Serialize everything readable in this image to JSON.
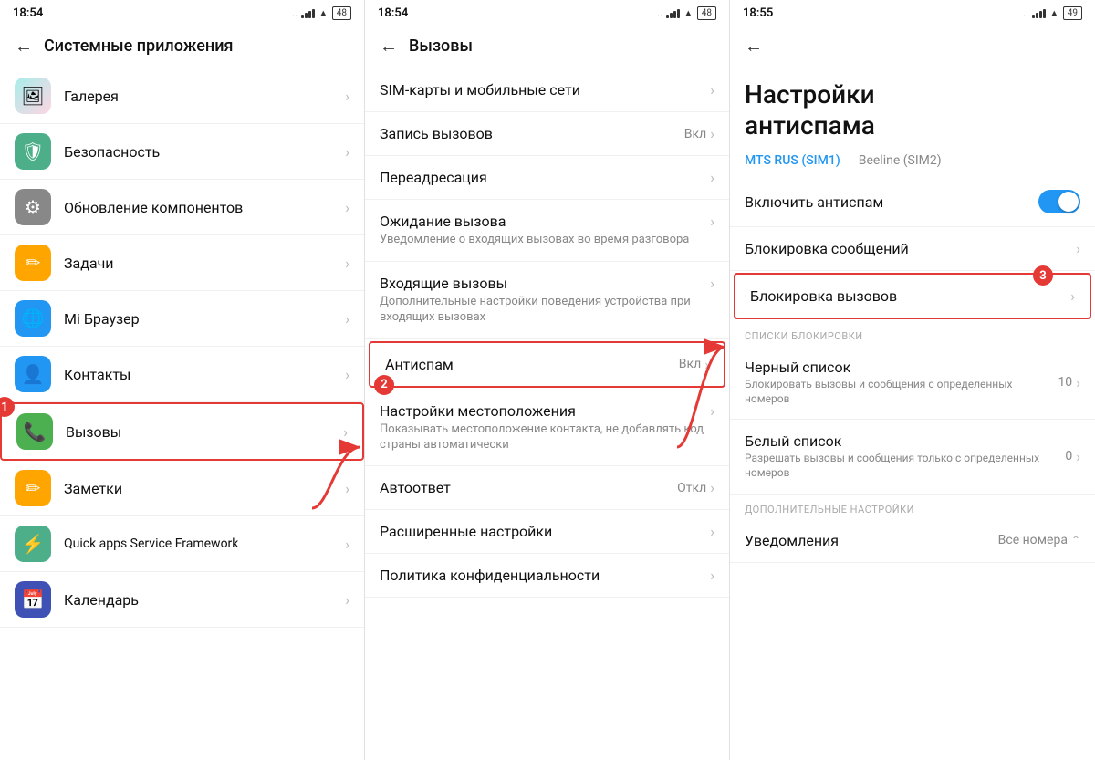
{
  "panels": {
    "p1": {
      "statusTime": "18:54",
      "statusDots": "..",
      "headerBack": "←",
      "headerTitle": "Системные приложения",
      "items": [
        {
          "id": "gallery",
          "icon": "🖼",
          "iconClass": "icon-gallery",
          "label": "Галерея",
          "highlighted": false
        },
        {
          "id": "security",
          "icon": "🛡",
          "iconClass": "icon-security",
          "label": "Безопасность",
          "highlighted": false
        },
        {
          "id": "update",
          "icon": "⚙",
          "iconClass": "icon-update",
          "label": "Обновление компонентов",
          "highlighted": false
        },
        {
          "id": "tasks",
          "icon": "✏",
          "iconClass": "icon-tasks",
          "label": "Задачи",
          "highlighted": false
        },
        {
          "id": "browser",
          "icon": "🌐",
          "iconClass": "icon-browser",
          "label": "Mi Браузер",
          "highlighted": false
        },
        {
          "id": "contacts",
          "icon": "👤",
          "iconClass": "icon-contacts",
          "label": "Контакты",
          "highlighted": false
        },
        {
          "id": "calls",
          "icon": "📞",
          "iconClass": "icon-calls",
          "label": "Вызовы",
          "highlighted": true
        },
        {
          "id": "notes",
          "icon": "✏",
          "iconClass": "icon-notes",
          "label": "Заметки",
          "highlighted": false
        },
        {
          "id": "quickapps",
          "icon": "⚡",
          "iconClass": "icon-quickapps",
          "label": "Quick apps Service Framework",
          "highlighted": false
        },
        {
          "id": "calendar",
          "icon": "📅",
          "iconClass": "icon-calendar",
          "label": "Календарь",
          "highlighted": false
        }
      ],
      "number": "1"
    },
    "p2": {
      "statusTime": "18:54",
      "statusDots": "..",
      "headerBack": "←",
      "headerTitle": "Вызовы",
      "items": [
        {
          "id": "sim",
          "title": "SIM-карты и мобильные сети",
          "sub": "",
          "value": "",
          "highlighted": false
        },
        {
          "id": "record",
          "title": "Запись вызовов",
          "sub": "",
          "value": "Вкл",
          "highlighted": false
        },
        {
          "id": "forward",
          "title": "Переадресация",
          "sub": "",
          "value": "",
          "highlighted": false
        },
        {
          "id": "waiting",
          "title": "Ожидание вызова",
          "sub": "Уведомление о входящих вызовах во время разговора",
          "value": "",
          "highlighted": false
        },
        {
          "id": "incoming",
          "title": "Входящие вызовы",
          "sub": "Дополнительные настройки поведения устройства при входящих вызовах",
          "value": "",
          "highlighted": false
        },
        {
          "id": "antispam",
          "title": "Антиспам",
          "sub": "",
          "value": "Вкл",
          "highlighted": true
        },
        {
          "id": "location",
          "title": "Настройки местоположения",
          "sub": "Показывать местоположение контакта, не добавлять код страны автоматически",
          "value": "",
          "highlighted": false
        },
        {
          "id": "autoanswer",
          "title": "Автоответ",
          "sub": "",
          "value": "Откл",
          "highlighted": false
        },
        {
          "id": "advanced",
          "title": "Расширенные настройки",
          "sub": "",
          "value": "",
          "highlighted": false
        },
        {
          "id": "privacy",
          "title": "Политика конфиденциальности",
          "sub": "",
          "value": "",
          "highlighted": false
        }
      ],
      "number": "2"
    },
    "p3": {
      "statusTime": "18:55",
      "statusDots": "..",
      "headerBack": "←",
      "title": "Настройки\nантиспама",
      "sim1Label": "MTS RUS (SIM1)",
      "sim2Label": "Beeline (SIM2)",
      "enableLabel": "Включить антиспам",
      "blockMessagesLabel": "Блокировка сообщений",
      "blockCallsLabel": "Блокировка вызовов",
      "blockListsSection": "СПИСКИ БЛОКИРОВКИ",
      "blackListLabel": "Черный список",
      "blackListSub": "Блокировать вызовы и сообщения с определенных номеров",
      "blackListCount": "10",
      "whiteListLabel": "Белый список",
      "whiteListSub": "Разрешать вызовы и сообщения только с определенных номеров",
      "whiteListCount": "0",
      "addSettingsSection": "ДОПОЛНИТЕЛЬНЫЕ НАСТРОЙКИ",
      "notificationsLabel": "Уведомления",
      "notificationsValue": "Все номера",
      "number": "3"
    }
  },
  "colors": {
    "red": "#e53935",
    "blue": "#2196f3",
    "toggleBlue": "#2196f3",
    "sim1Color": "#2196f3",
    "sim2Color": "#555"
  }
}
